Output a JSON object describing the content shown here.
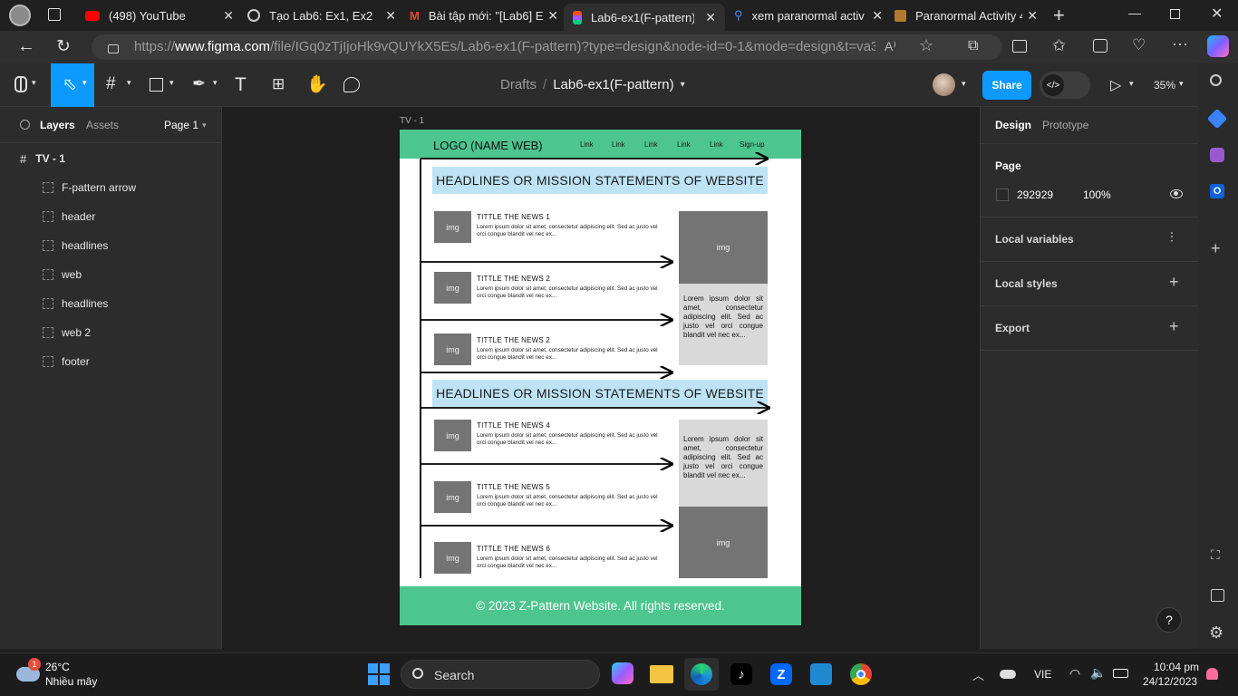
{
  "browser": {
    "tabs": [
      {
        "title": "(498) YouTube",
        "icon": "youtube-icon",
        "color": "#ff0000"
      },
      {
        "title": "Tạo Lab6: Ex1, Ex2",
        "icon": "chatgpt-icon",
        "color": "#cccccc"
      },
      {
        "title": "Bài tập mới: \"[Lab6] E",
        "icon": "gmail-icon",
        "color": "#ea4335"
      },
      {
        "title": "Lab6-ex1(F-pattern) -",
        "icon": "figma-icon",
        "color": "#a259ff",
        "active": true
      },
      {
        "title": "xem paranormal activ",
        "icon": "search-icon",
        "color": "#4a8df8"
      },
      {
        "title": "Paranormal Activity 4",
        "icon": "movie-icon",
        "color": "#e0a030"
      }
    ],
    "url_prefix": "https://",
    "url_domain": "www.figma.com",
    "url_rest": "/file/IGq0zTjIjoHk9vQUYkX5Es/Lab6-ex1(F-pattern)?type=design&node-id=0-1&mode=design&t=va3P2O..."
  },
  "figma": {
    "breadcrumb_root": "Drafts",
    "breadcrumb_separator": "/",
    "file_name": "Lab6-ex1(F-pattern)",
    "share_label": "Share",
    "zoom": "35%",
    "left": {
      "tab_layers": "Layers",
      "tab_assets": "Assets",
      "page": "Page 1",
      "frame_layer": "TV - 1",
      "layers": [
        "F-pattern arrow",
        "header",
        "headlines",
        "web",
        "headlines",
        "web 2",
        "footer"
      ]
    },
    "right": {
      "tab_design": "Design",
      "tab_prototype": "Prototype",
      "page_label": "Page",
      "bg_hex": "292929",
      "bg_opacity": "100%",
      "local_variables": "Local variables",
      "local_styles": "Local styles",
      "export": "Export"
    },
    "help": "?"
  },
  "frame": {
    "name": "TV - 1",
    "logo": "LOGO (NAME WEB)",
    "nav": [
      "Link",
      "Link",
      "Link",
      "Link",
      "Link",
      "Sign-up"
    ],
    "headline": "HEADLINES OR MISSION STATEMENTS OF WEBSITE",
    "img_label": "img",
    "lorem": "Lorem ipsum dolor sit amet, consectetur adipiscing elit. Sed ac justo vel orci congue blandit vel nec ex...",
    "news": [
      {
        "title": "TITTLE  THE NEWS 1"
      },
      {
        "title": "TITTLE  THE NEWS 2"
      },
      {
        "title": "TITTLE  THE NEWS 2"
      },
      {
        "title": "TITTLE  THE NEWS 4"
      },
      {
        "title": "TITTLE  THE NEWS 5"
      },
      {
        "title": "TITTLE  THE NEWS 6"
      }
    ],
    "footer": "© 2023 Z-Pattern Website. All rights reserved."
  },
  "taskbar": {
    "weather_temp": "26°C",
    "weather_desc": "Nhiều mây",
    "weather_badge": "1",
    "search": "Search",
    "lang": "VIE",
    "time": "10:04 pm",
    "date": "24/12/2023"
  },
  "colors": {
    "accent": "#0d99ff",
    "frame_green": "#4dc58e",
    "headline_blue": "#bde3f5",
    "share": "#0d99ff"
  }
}
